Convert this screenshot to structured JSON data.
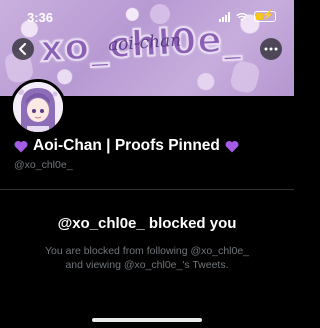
{
  "status_bar": {
    "time": "3:36",
    "battery_color": "#f5c518"
  },
  "banner": {
    "word_art": "xo_chl0e_",
    "script_text": "aoi-chan",
    "colors": {
      "base": "#b89ad3",
      "text": "#8a5fb4"
    }
  },
  "header": {
    "back_icon": "chevron-left-icon",
    "more_icon": "more-horizontal-icon"
  },
  "profile": {
    "display_name": "Aoi-Chan | Proofs Pinned",
    "heart_color": "#a35ce6",
    "handle": "@xo_chl0e_"
  },
  "blocked": {
    "title": "@xo_chl0e_ blocked you",
    "line1": "You are blocked from following @xo_chl0e_",
    "line2": "and viewing @xo_chl0e_'s Tweets."
  },
  "theme": {
    "background": "#000000",
    "secondary_text": "#71767b",
    "divider": "#2f3336"
  }
}
